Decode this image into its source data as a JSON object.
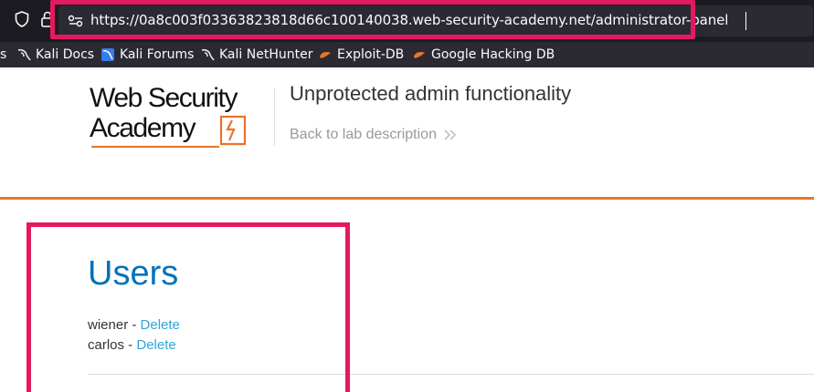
{
  "browser": {
    "url": "https://0a8c003f03363823818d66c100140038.web-security-academy.net/administrator-panel",
    "bookmarks": [
      {
        "label": "s",
        "icon": "none"
      },
      {
        "label": "Kali Docs",
        "icon": "kali-dragon-icon"
      },
      {
        "label": "Kali Forums",
        "icon": "kali-forums-icon"
      },
      {
        "label": "Kali NetHunter",
        "icon": "kali-dragon-icon"
      },
      {
        "label": "Exploit-DB",
        "icon": "exploit-db-icon"
      },
      {
        "label": "Google Hacking DB",
        "icon": "exploit-db-icon"
      }
    ]
  },
  "header": {
    "logo_line1": "Web Security",
    "logo_line2": "Academy",
    "lab_title": "Unprotected admin functionality",
    "back_link": "Back to lab description"
  },
  "main": {
    "title": "Users",
    "users": [
      {
        "name": "wiener",
        "separator": " - ",
        "action": "Delete"
      },
      {
        "name": "carlos",
        "separator": " - ",
        "action": "Delete"
      }
    ]
  },
  "colors": {
    "accent_orange": "#e8742d",
    "link_blue": "#2ea5d6",
    "title_blue": "#0071bc",
    "highlight": "#e5195f"
  }
}
